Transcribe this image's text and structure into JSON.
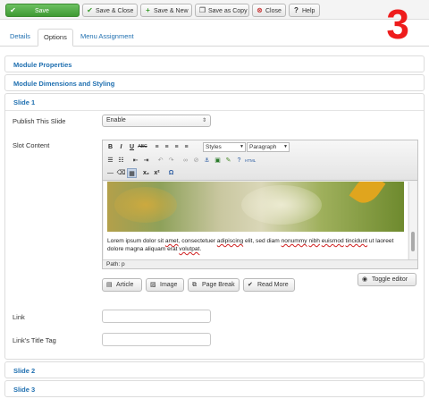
{
  "toolbar": {
    "save": "Save",
    "save_close": "Save & Close",
    "save_new": "Save & New",
    "save_copy": "Save as Copy",
    "close": "Close",
    "help": "Help"
  },
  "step_number": "3",
  "tabs": [
    "Details",
    "Options",
    "Menu Assignment"
  ],
  "panels": {
    "module_properties": "Module Properties",
    "module_dimensions": "Module Dimensions and Styling",
    "slide1": "Slide 1",
    "slide2": "Slide 2",
    "slide3": "Slide 3"
  },
  "fields": {
    "publish_label": "Publish This Slide",
    "publish_value": "Enable",
    "slot_label": "Slot Content",
    "link_label": "Link",
    "link_value": "",
    "link_title_label": "Link's Title Tag",
    "link_title_value": ""
  },
  "editor": {
    "styles": "Styles",
    "paragraph": "Paragraph",
    "text_parts": [
      "Lorem ipsum dolor sit ",
      "amet",
      ", consectetuer ",
      "adipiscing",
      " elit, sed diam ",
      "nonummy",
      " ",
      "nibh",
      " ",
      "euismod",
      " ",
      "tincidunt",
      " ut laoreet dolore magna aliquam erat ",
      "volutpat",
      "."
    ],
    "path": "Path: p",
    "html_badge": "HTML"
  },
  "editor_buttons": {
    "article": "Article",
    "image": "Image",
    "page_break": "Page Break",
    "read_more": "Read More",
    "toggle": "Toggle editor"
  },
  "icons": [
    "check-icon",
    "check-icon",
    "plus-icon",
    "copy-icon",
    "close-icon",
    "help-icon",
    "eye-icon",
    "article-icon",
    "image-icon",
    "page-break-icon",
    "read-more-icon"
  ]
}
